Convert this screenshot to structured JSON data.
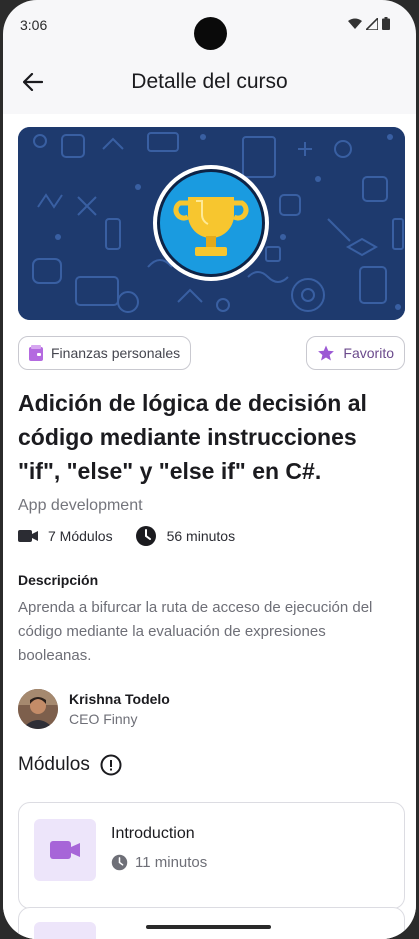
{
  "status_bar": {
    "time": "3:06",
    "icons": [
      "wifi-icon",
      "signal-icon",
      "battery-icon"
    ]
  },
  "app_bar": {
    "title": "Detalle del curso",
    "back_icon": "arrow-left-icon"
  },
  "banner": {
    "icon": "trophy-icon",
    "colors": {
      "background": "#1e3a6e",
      "badge": "#1a9be0",
      "trophy": "#f7c62f"
    }
  },
  "chips": {
    "category": {
      "label": "Finanzas personales",
      "icon": "wallet-icon",
      "color": "#b46ae0"
    },
    "favorite": {
      "label": "Favorito",
      "icon": "star-icon",
      "color": "#9b58d4"
    }
  },
  "course": {
    "title": "Adición de lógica de decisión al código mediante instrucciones \"if\", \"else\" y \"else if\" en C#.",
    "category": "App development",
    "modules_count": "7 Módulos",
    "duration": "56 minutos"
  },
  "description": {
    "label": "Descripción",
    "text": "Aprenda a bifurcar la ruta de acceso de ejecución del código mediante la evaluación de expresiones booleanas."
  },
  "author": {
    "name": "Krishna Todelo",
    "role": "CEO Finny"
  },
  "modules": {
    "header": "Módulos",
    "info_icon": "info-circle-icon",
    "items": [
      {
        "name": "Introduction",
        "duration": "11 minutos",
        "icon": "video-camera-icon"
      }
    ]
  },
  "colors": {
    "accent": "#9b58d4",
    "text_primary": "#1b1b1f",
    "text_secondary": "#6e6f77"
  }
}
